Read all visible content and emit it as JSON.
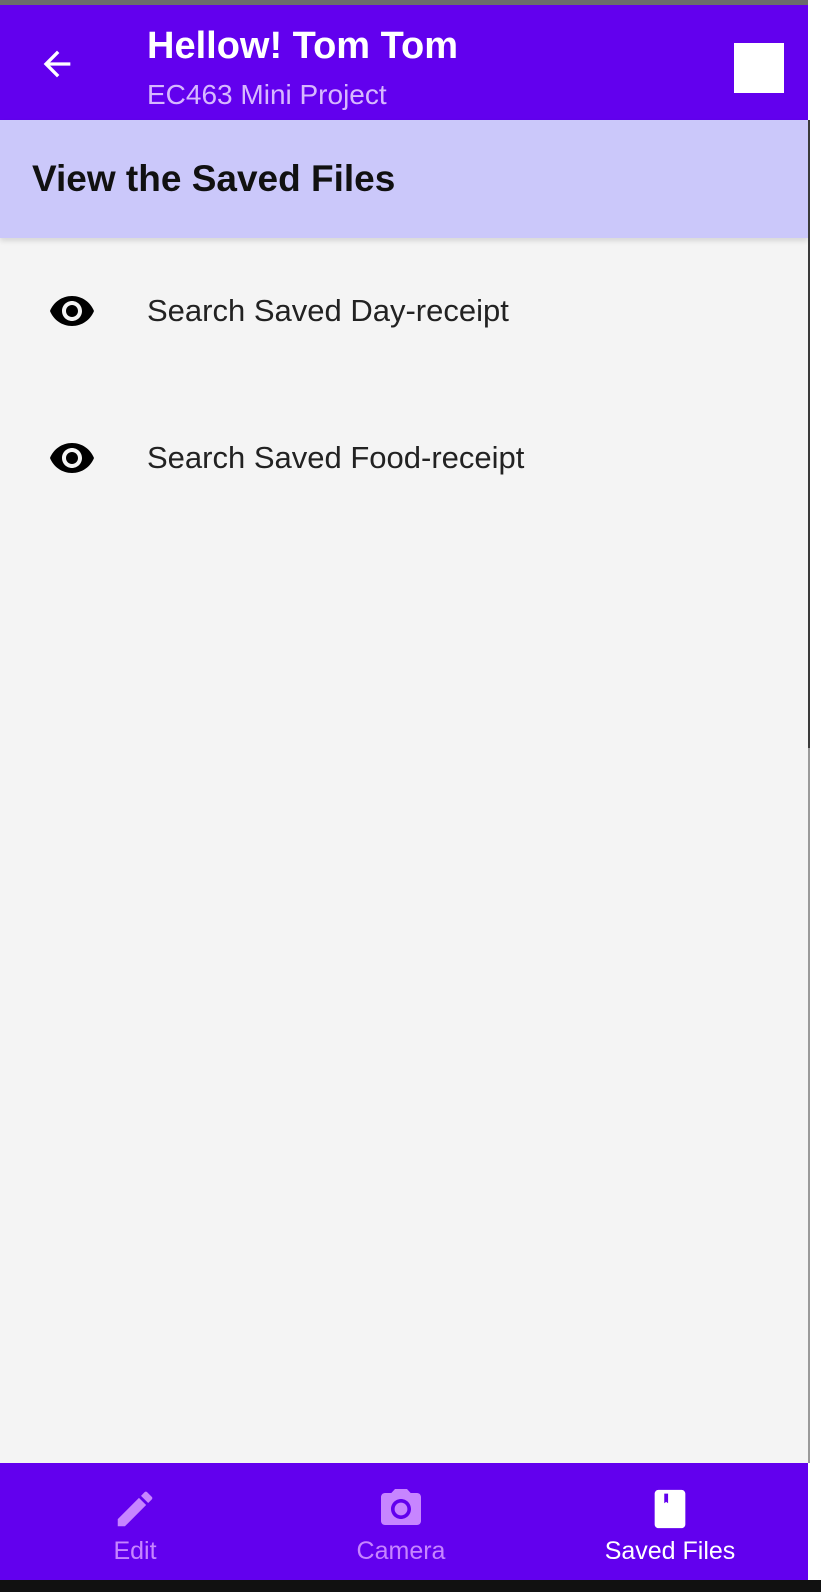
{
  "appbar": {
    "title": "Hellow! Tom Tom",
    "subtitle": "EC463 Mini Project",
    "back_icon": "arrow-left-icon",
    "action_icon": "white-square"
  },
  "section": {
    "title": "View the Saved Files"
  },
  "list": {
    "items": [
      {
        "label": "Search Saved Day-receipt",
        "icon": "eye-icon"
      },
      {
        "label": "Search Saved Food-receipt",
        "icon": "eye-icon"
      }
    ]
  },
  "bottom_nav": {
    "items": [
      {
        "label": "Edit",
        "icon": "pencil-icon",
        "active": false
      },
      {
        "label": "Camera",
        "icon": "camera-icon",
        "active": false
      },
      {
        "label": "Saved Files",
        "icon": "book-icon",
        "active": true
      }
    ]
  },
  "colors": {
    "primary": "#6200ee",
    "section_bg": "#cbc8fa",
    "background": "#f4f4f4",
    "subtitle": "#d7b8ff",
    "nav_inactive": "#c785ff",
    "nav_active": "#ffffff"
  }
}
